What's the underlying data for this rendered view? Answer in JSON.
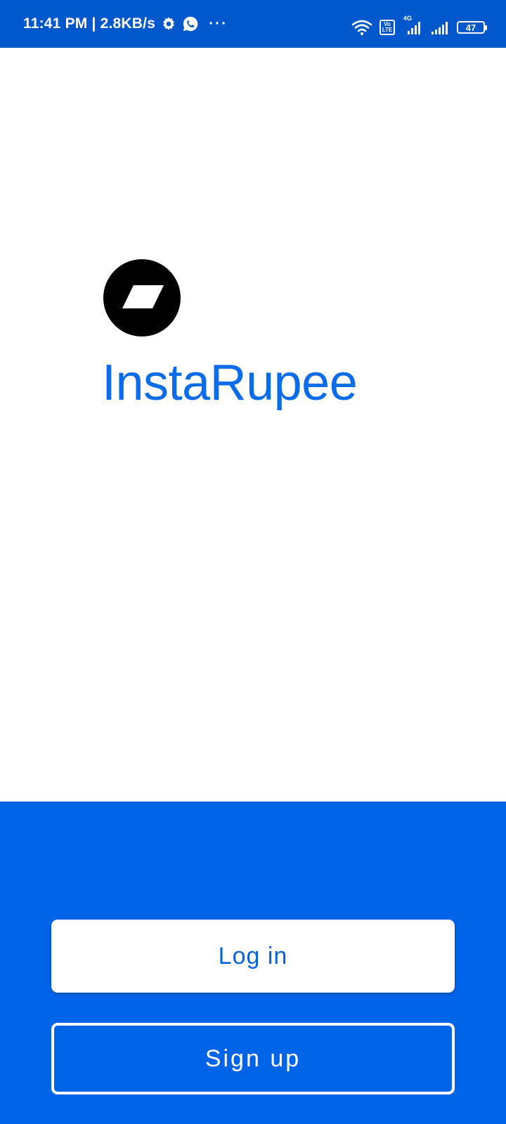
{
  "status_bar": {
    "time_speed": "11:41 PM | 2.8KB/s",
    "more_dots": "···",
    "volte_top": "Vo",
    "volte_bottom": "LTE",
    "network_type": "4G",
    "battery": "47",
    "icons": [
      "gear-icon",
      "whatsapp-icon",
      "wifi-icon",
      "volte-icon",
      "signal-icon",
      "battery-icon"
    ]
  },
  "brand": {
    "name": "InstaRupee",
    "color": "#0A6CE8"
  },
  "actions": {
    "login_label": "Log in",
    "signup_label": "Sign up"
  },
  "colors": {
    "status_bar": "#0058CC",
    "panel": "#0064E8",
    "login_text": "#0A62D8"
  }
}
